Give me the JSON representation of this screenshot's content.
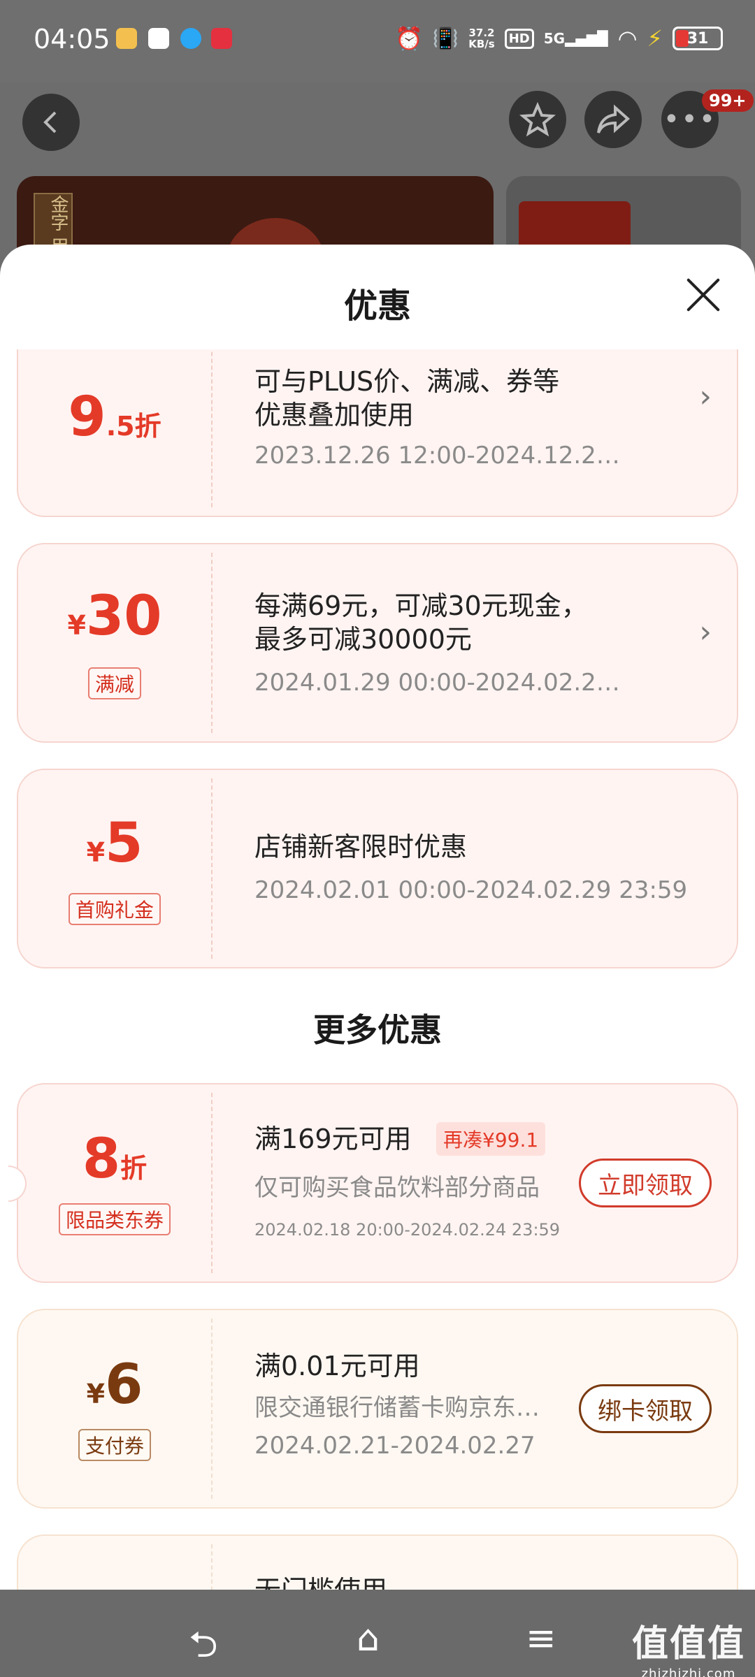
{
  "status_bar": {
    "time": "04:05",
    "network_speed": "37.2",
    "network_speed_unit": "KB/s",
    "hd_label": "HD",
    "signal_label": "5G",
    "battery": "31",
    "app_icons": [
      "app-bubble-icon",
      "app-mail-icon",
      "app-qq-icon",
      "app-xiaohongshu-icon"
    ]
  },
  "background_page": {
    "cart_badge": "99+",
    "product_label": "金字 用心精制"
  },
  "sheet": {
    "title": "优惠",
    "promotions": [
      {
        "value_main": "9",
        "value_suffix": ".5折",
        "desc_line1": "可与PLUS价、满减、券等",
        "desc_line2": "优惠叠加使用",
        "date": "2023.12.26 12:00-2024.12.2…"
      },
      {
        "currency": "¥",
        "value_main": "30",
        "tag": "满减",
        "desc_line1": "每满69元，可减30元现金，",
        "desc_line2": "最多可减30000元",
        "date": "2024.01.29 00:00-2024.02.2…"
      },
      {
        "currency": "¥",
        "value_main": "5",
        "tag": "首购礼金",
        "desc_line1": "店铺新客限时优惠",
        "date": "2024.02.01 00:00-2024.02.29 23:59"
      }
    ],
    "more_title": "更多优惠",
    "coupons": [
      {
        "value_main": "8",
        "value_suffix": "折",
        "tag": "限品类东券",
        "condition": "满169元可用",
        "hint": "再凑¥99.1",
        "scope": "仅可购买食品饮料部分商品",
        "date": "2024.02.18 20:00-2024.02.24 23:59",
        "button": "立即领取"
      },
      {
        "currency": "¥",
        "value_main": "6",
        "tag": "支付券",
        "condition": "满0.01元可用",
        "scope": "限交通银行储蓄卡购京东…",
        "date": "2024.02.21-2024.02.27",
        "button": "绑卡领取"
      },
      {
        "partial_text": "无门槛使用"
      }
    ]
  },
  "nav_bar": {
    "back_glyph": "⮌",
    "home_glyph": "⌂",
    "menu_glyph": "≡"
  },
  "watermark": {
    "text": "值值值",
    "domain": "zhizhizhi.com"
  },
  "colors": {
    "accent_red": "#e43a28",
    "brown": "#7a3a10",
    "card_pink": "#fff4f2"
  }
}
